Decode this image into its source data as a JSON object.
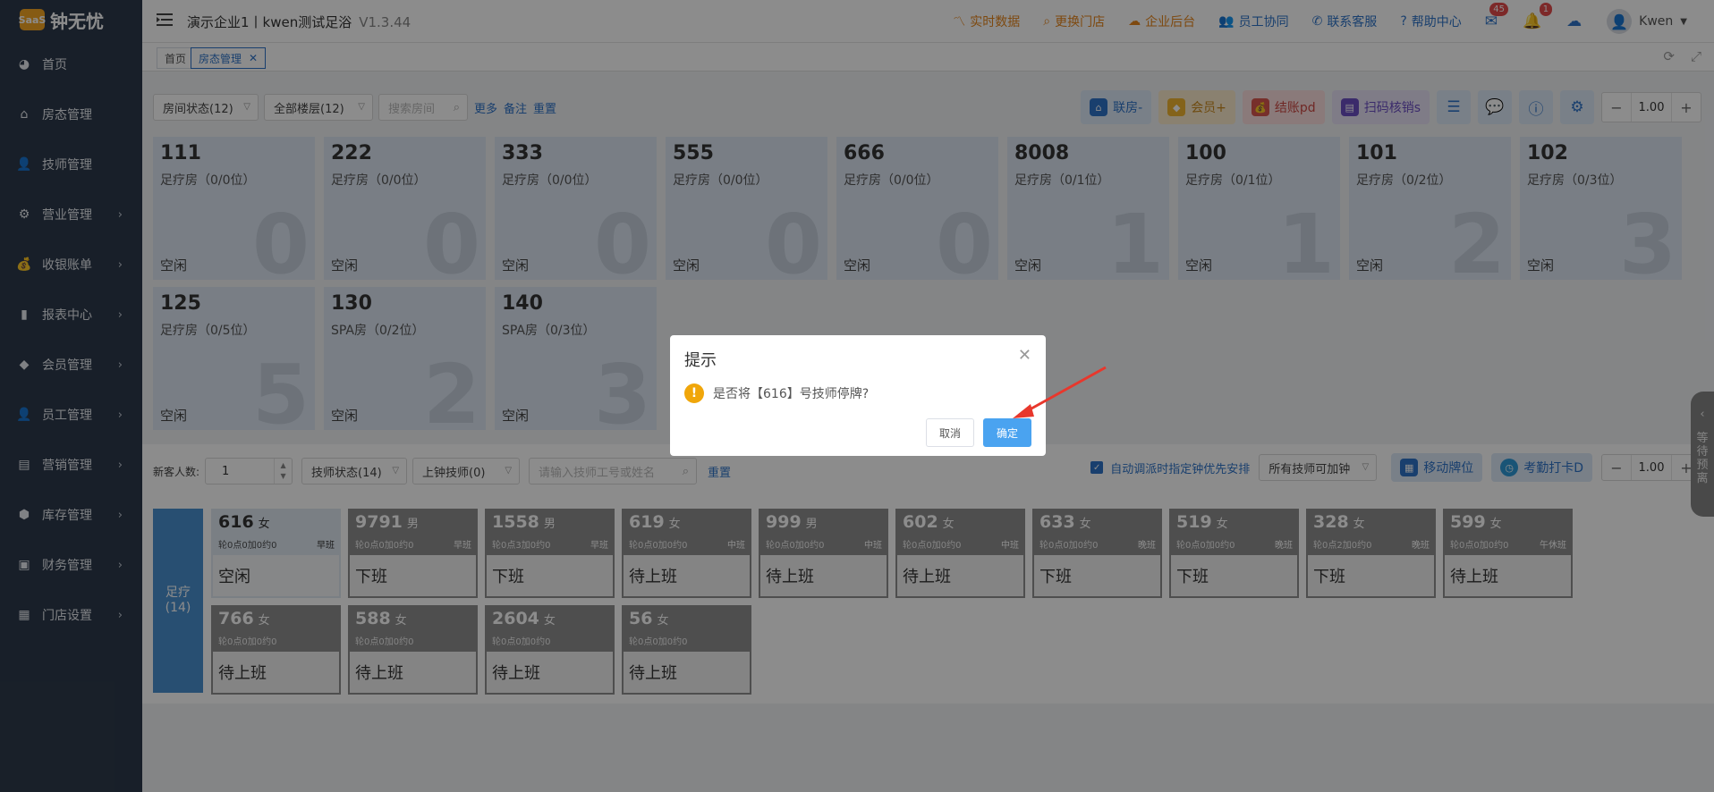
{
  "app": {
    "logo_text": "钟无忧",
    "logo_icon_text": "SaaS"
  },
  "sidebar": {
    "items": [
      {
        "label": "首页",
        "icon": "dashboard-icon",
        "arrow": false
      },
      {
        "label": "房态管理",
        "icon": "home-icon",
        "arrow": false
      },
      {
        "label": "技师管理",
        "icon": "user-icon",
        "arrow": false
      },
      {
        "label": "营业管理",
        "icon": "gear-icon",
        "arrow": true
      },
      {
        "label": "收银账单",
        "icon": "money-bag-icon",
        "arrow": true
      },
      {
        "label": "报表中心",
        "icon": "bar-chart-icon",
        "arrow": true
      },
      {
        "label": "会员管理",
        "icon": "diamond-icon",
        "arrow": true
      },
      {
        "label": "员工管理",
        "icon": "user-icon",
        "arrow": true
      },
      {
        "label": "营销管理",
        "icon": "briefcase-icon",
        "arrow": true
      },
      {
        "label": "库存管理",
        "icon": "cube-icon",
        "arrow": true
      },
      {
        "label": "财务管理",
        "icon": "wallet-icon",
        "arrow": true
      },
      {
        "label": "门店设置",
        "icon": "grid-icon",
        "arrow": true
      }
    ]
  },
  "header": {
    "title": "演示企业1丨kwen测试足浴",
    "version": "V1.3.44",
    "links": [
      {
        "label": "实时数据",
        "icon": "pulse-icon"
      },
      {
        "label": "更换门店",
        "icon": "search-icon"
      },
      {
        "label": "企业后台",
        "icon": "cloud-icon"
      },
      {
        "label": "员工协同",
        "icon": "users-icon"
      },
      {
        "label": "联系客服",
        "icon": "phone-icon"
      },
      {
        "label": "帮助中心",
        "icon": "help-icon"
      }
    ],
    "mail_badge": "45",
    "bell_badge": "1",
    "user": "Kwen"
  },
  "tabs": [
    {
      "label": "首页"
    },
    {
      "label": "房态管理"
    }
  ],
  "room_filters": {
    "room_status": "房间状态(12)",
    "floor": "全部楼层(12)",
    "search_placeholder": "搜索房间",
    "more": "更多",
    "note": "备注",
    "reset": "重置"
  },
  "room_actions": [
    {
      "label": "联房-",
      "color": "blue",
      "icon": "house-icon"
    },
    {
      "label": "会员+",
      "color": "yellow",
      "icon": "diamond-icon"
    },
    {
      "label": "结账pd",
      "color": "red",
      "icon": "money-bag-icon"
    },
    {
      "label": "扫码核销s",
      "color": "purple",
      "icon": "scan-icon"
    }
  ],
  "room_zoom": "1.00",
  "rooms": [
    {
      "num": "111",
      "type": "足疗房（0/0位）",
      "status": "空闲",
      "count": "0"
    },
    {
      "num": "222",
      "type": "足疗房（0/0位）",
      "status": "空闲",
      "count": "0"
    },
    {
      "num": "333",
      "type": "足疗房（0/0位）",
      "status": "空闲",
      "count": "0"
    },
    {
      "num": "555",
      "type": "足疗房（0/0位）",
      "status": "空闲",
      "count": "0"
    },
    {
      "num": "666",
      "type": "足疗房（0/0位）",
      "status": "空闲",
      "count": "0"
    },
    {
      "num": "8008",
      "type": "足疗房（0/1位）",
      "status": "空闲",
      "count": "1"
    },
    {
      "num": "100",
      "type": "足疗房（0/1位）",
      "status": "空闲",
      "count": "1"
    },
    {
      "num": "101",
      "type": "足疗房（0/2位）",
      "status": "空闲",
      "count": "2"
    },
    {
      "num": "102",
      "type": "足疗房（0/3位）",
      "status": "空闲",
      "count": "3"
    },
    {
      "num": "125",
      "type": "足疗房（0/5位）",
      "status": "空闲",
      "count": "5"
    },
    {
      "num": "130",
      "type": "SPA房（0/2位）",
      "status": "空闲",
      "count": "2"
    },
    {
      "num": "140",
      "type": "SPA房（0/3位）",
      "status": "空闲",
      "count": "3"
    }
  ],
  "tech_bar": {
    "new_guests_label": "新客人数:",
    "new_guests_value": "1",
    "tech_status": "技师状态(14)",
    "on_clock": "上钟技师(0)",
    "search_placeholder": "请输入技师工号或姓名",
    "reset": "重置",
    "auto_dispatch": "自动调派时指定钟优先安排",
    "all_overtime": "所有技师可加钟",
    "move_card": "移动牌位",
    "attendance": "考勤打卡D",
    "zoom": "1.00"
  },
  "tech_group": {
    "label": "足疗",
    "count": "(14)"
  },
  "technicians": [
    {
      "num": "616",
      "gender": "女",
      "stats": "轮0点0加0约0",
      "shift": "早班",
      "status": "空闲",
      "free": true
    },
    {
      "num": "9791",
      "gender": "男",
      "stats": "轮0点0加0约0",
      "shift": "早班",
      "status": "下班",
      "free": false
    },
    {
      "num": "1558",
      "gender": "男",
      "stats": "轮0点3加0约0",
      "shift": "早班",
      "status": "下班",
      "free": false
    },
    {
      "num": "619",
      "gender": "女",
      "stats": "轮0点0加0约0",
      "shift": "中班",
      "status": "待上班",
      "free": false
    },
    {
      "num": "999",
      "gender": "男",
      "stats": "轮0点0加0约0",
      "shift": "中班",
      "status": "待上班",
      "free": false
    },
    {
      "num": "602",
      "gender": "女",
      "stats": "轮0点0加0约0",
      "shift": "中班",
      "status": "待上班",
      "free": false
    },
    {
      "num": "633",
      "gender": "女",
      "stats": "轮0点0加0约0",
      "shift": "晚班",
      "status": "下班",
      "free": false
    },
    {
      "num": "519",
      "gender": "女",
      "stats": "轮0点0加0约0",
      "shift": "晚班",
      "status": "下班",
      "free": false
    },
    {
      "num": "328",
      "gender": "女",
      "stats": "轮0点2加0约0",
      "shift": "晚班",
      "status": "下班",
      "free": false
    },
    {
      "num": "599",
      "gender": "女",
      "stats": "轮0点0加0约0",
      "shift": "午休班",
      "status": "待上班",
      "free": false
    },
    {
      "num": "766",
      "gender": "女",
      "stats": "轮0点0加0约0",
      "shift": "",
      "status": "待上班",
      "free": false
    },
    {
      "num": "588",
      "gender": "女",
      "stats": "轮0点0加0约0",
      "shift": "",
      "status": "待上班",
      "free": false
    },
    {
      "num": "2604",
      "gender": "女",
      "stats": "轮0点0加0约0",
      "shift": "",
      "status": "待上班",
      "free": false
    },
    {
      "num": "56",
      "gender": "女",
      "stats": "轮0点0加0约0",
      "shift": "",
      "status": "待上班",
      "free": false
    }
  ],
  "side_tab": {
    "chars": [
      "等",
      "待",
      "预",
      "离"
    ]
  },
  "dialog": {
    "title": "提示",
    "message": "是否将【616】号技师停牌?",
    "cancel": "取消",
    "ok": "确定"
  },
  "colors": {
    "accent": "#2f74c8",
    "sidebar": "#2d3a4b",
    "ok": "#4aa3f0",
    "warn": "#f0a60a"
  }
}
